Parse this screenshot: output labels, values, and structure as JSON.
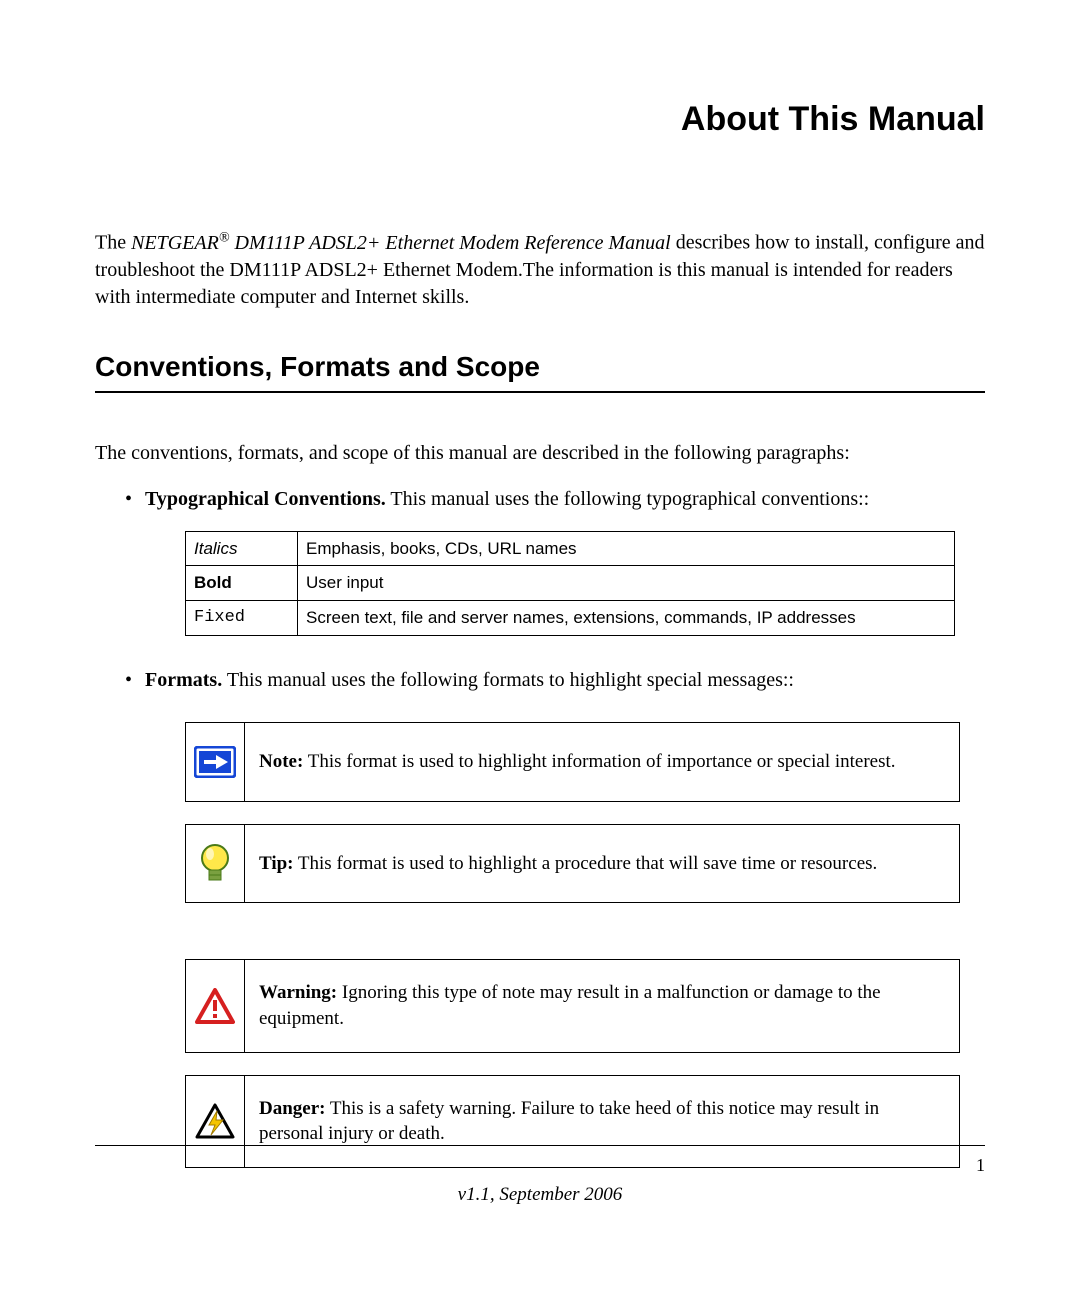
{
  "title": "About This Manual",
  "intro": {
    "prefix": "The ",
    "manual_name": "NETGEAR",
    "reg": "®",
    "manual_rest": " DM111P ADSL2+ Ethernet Modem Reference Manual",
    "after": " describes how to install, configure and troubleshoot the DM111P ADSL2+ Ethernet Modem.The information is this manual is intended for readers with intermediate computer and Internet skills."
  },
  "section_heading": "Conventions, Formats and Scope",
  "section_intro": "The conventions, formats, and scope of this manual are described in the following paragraphs:",
  "bullet_typo_label": "Typographical Conventions.",
  "bullet_typo_text": " This manual uses the following typographical conventions::",
  "conv_table": {
    "rows": [
      {
        "label": "Italics",
        "desc": "Emphasis, books, CDs, URL names",
        "style": "italic"
      },
      {
        "label": "Bold",
        "desc": "User input",
        "style": "bold"
      },
      {
        "label": "Fixed",
        "desc": "Screen text, file and server names, extensions, commands, IP addresses",
        "style": "fixed"
      }
    ]
  },
  "bullet_formats_label": "Formats.",
  "bullet_formats_text": " This manual uses the following formats to highlight special messages::",
  "note": {
    "label": "Note:",
    "text": " This format is used to highlight information of importance or special interest."
  },
  "tip": {
    "label": "Tip:",
    "text": " This format is used to highlight a procedure that will save time or resources."
  },
  "warning": {
    "label": "Warning:",
    "text": " Ignoring this type of note may result in a malfunction or damage to the equipment."
  },
  "danger": {
    "label": "Danger:",
    "text": " This is a safety warning. Failure to take heed of this notice may result in personal injury or death."
  },
  "page_number": "1",
  "version_footer": "v1.1, September 2006"
}
